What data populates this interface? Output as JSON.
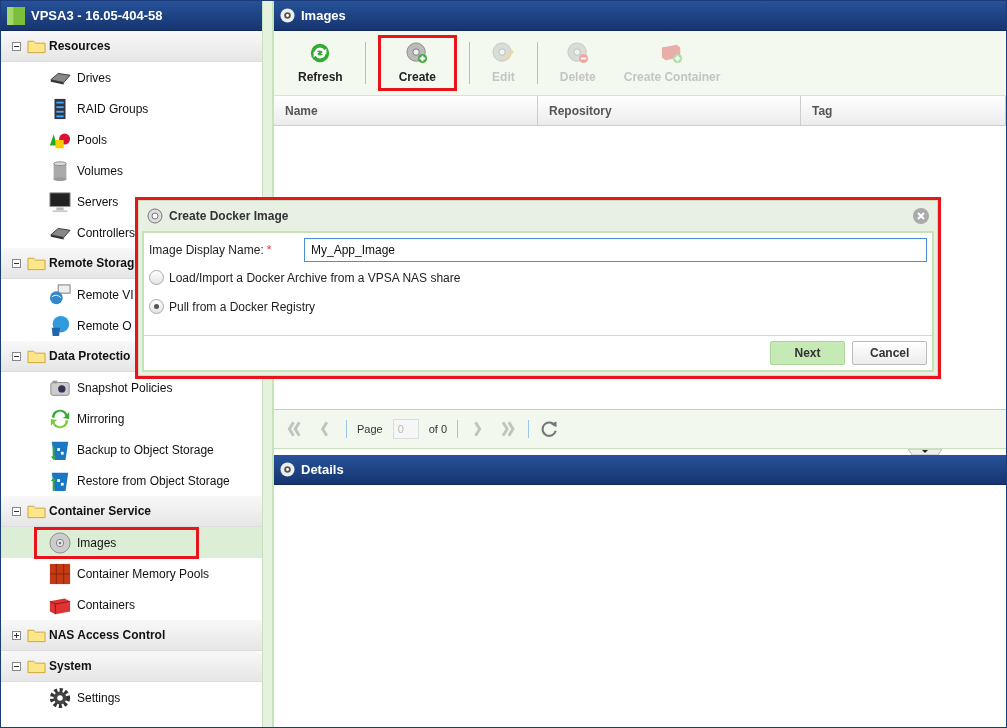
{
  "sidebar": {
    "title": "VPSA3 - 16.05-404-58",
    "groups": [
      {
        "label": "Resources",
        "expanded": true,
        "items": [
          {
            "label": "Drives",
            "selected": false,
            "highlighted": false
          },
          {
            "label": "RAID Groups",
            "selected": false,
            "highlighted": false
          },
          {
            "label": "Pools",
            "selected": false,
            "highlighted": false
          },
          {
            "label": "Volumes",
            "selected": false,
            "highlighted": false
          },
          {
            "label": "Servers",
            "selected": false,
            "highlighted": false
          },
          {
            "label": "Controllers",
            "selected": false,
            "highlighted": false
          }
        ]
      },
      {
        "label": "Remote Storag",
        "expanded": true,
        "items": [
          {
            "label": "Remote VI",
            "selected": false,
            "highlighted": false
          },
          {
            "label": "Remote O",
            "selected": false,
            "highlighted": false
          }
        ]
      },
      {
        "label": "Data Protectio",
        "expanded": true,
        "items": [
          {
            "label": "Snapshot Policies",
            "selected": false,
            "highlighted": false
          },
          {
            "label": "Mirroring",
            "selected": false,
            "highlighted": false
          },
          {
            "label": "Backup to Object Storage",
            "selected": false,
            "highlighted": false
          },
          {
            "label": "Restore from Object Storage",
            "selected": false,
            "highlighted": false
          }
        ]
      },
      {
        "label": "Container Service",
        "expanded": true,
        "items": [
          {
            "label": "Images",
            "selected": true,
            "highlighted": true
          },
          {
            "label": "Container Memory Pools",
            "selected": false,
            "highlighted": false
          },
          {
            "label": "Containers",
            "selected": false,
            "highlighted": false
          }
        ]
      },
      {
        "label": "NAS Access Control",
        "expanded": false
      },
      {
        "label": "System",
        "expanded": true,
        "items": [
          {
            "label": "Settings",
            "selected": false,
            "highlighted": false
          }
        ]
      }
    ]
  },
  "images_panel": {
    "title": "Images",
    "toolbar": [
      {
        "label": "Refresh",
        "disabled": false,
        "highlighted": false
      },
      {
        "label": "Create",
        "disabled": false,
        "highlighted": true
      },
      {
        "label": "Edit",
        "disabled": true,
        "highlighted": false
      },
      {
        "label": "Delete",
        "disabled": true,
        "highlighted": false
      },
      {
        "label": "Create Container",
        "disabled": true,
        "highlighted": false
      }
    ],
    "table": {
      "columns": [
        "Name",
        "Repository",
        "Tag"
      ]
    },
    "pager": {
      "page_label": "Page",
      "page_value": "0",
      "of_label": "of 0",
      "navigation_disabled": true
    }
  },
  "details_panel": {
    "title": "Details"
  },
  "dialog": {
    "title": "Create Docker Image",
    "highlighted": true,
    "name_field": {
      "label": "Image Display Name:",
      "required_mark": "*",
      "value": "My_App_Image"
    },
    "options": [
      {
        "label": "Load/Import a Docker Archive from a VPSA NAS share",
        "selected": false
      },
      {
        "label": "Pull from a Docker Registry",
        "selected": true
      }
    ],
    "buttons": [
      {
        "label": "Next",
        "kind": "primary"
      },
      {
        "label": "Cancel",
        "kind": "secondary"
      }
    ]
  }
}
